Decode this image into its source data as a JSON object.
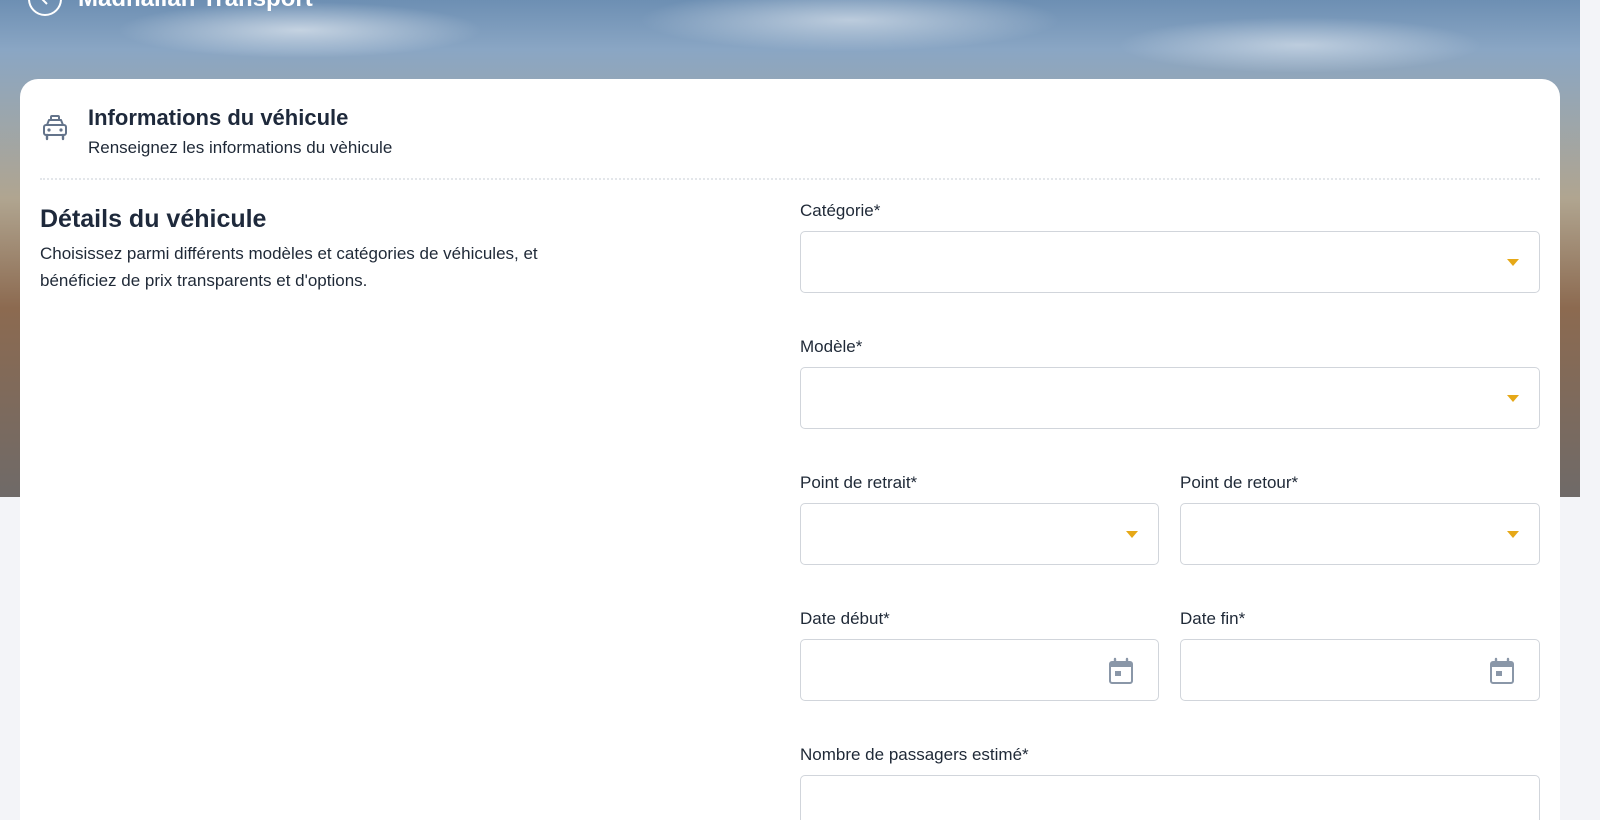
{
  "hero": {
    "title": "Madhalian Transport"
  },
  "card": {
    "title": "Informations du véhicule",
    "subtitle": "Renseignez les informations du vèhicule"
  },
  "section": {
    "title": "Détails du véhicule",
    "description": "Choisissez parmi différents modèles et catégories de véhicules, et bénéficiez de prix transparents et d'options."
  },
  "form": {
    "categorie": {
      "label": "Catégorie*",
      "value": ""
    },
    "modele": {
      "label": "Modèle*",
      "value": ""
    },
    "point_retrait": {
      "label": "Point de retrait*",
      "value": ""
    },
    "point_retour": {
      "label": "Point de retour*",
      "value": ""
    },
    "date_debut": {
      "label": "Date début*",
      "value": ""
    },
    "date_fin": {
      "label": "Date fin*",
      "value": ""
    },
    "passagers": {
      "label": "Nombre de passagers estimé*",
      "value": ""
    }
  },
  "icons": {
    "header": "taxi-icon",
    "dropdown": "caret-down-icon",
    "date": "calendar-icon"
  },
  "colors": {
    "accent": "#e6a817",
    "title": "#1e293b",
    "border": "#d1d5db",
    "icon": "#64748b"
  }
}
